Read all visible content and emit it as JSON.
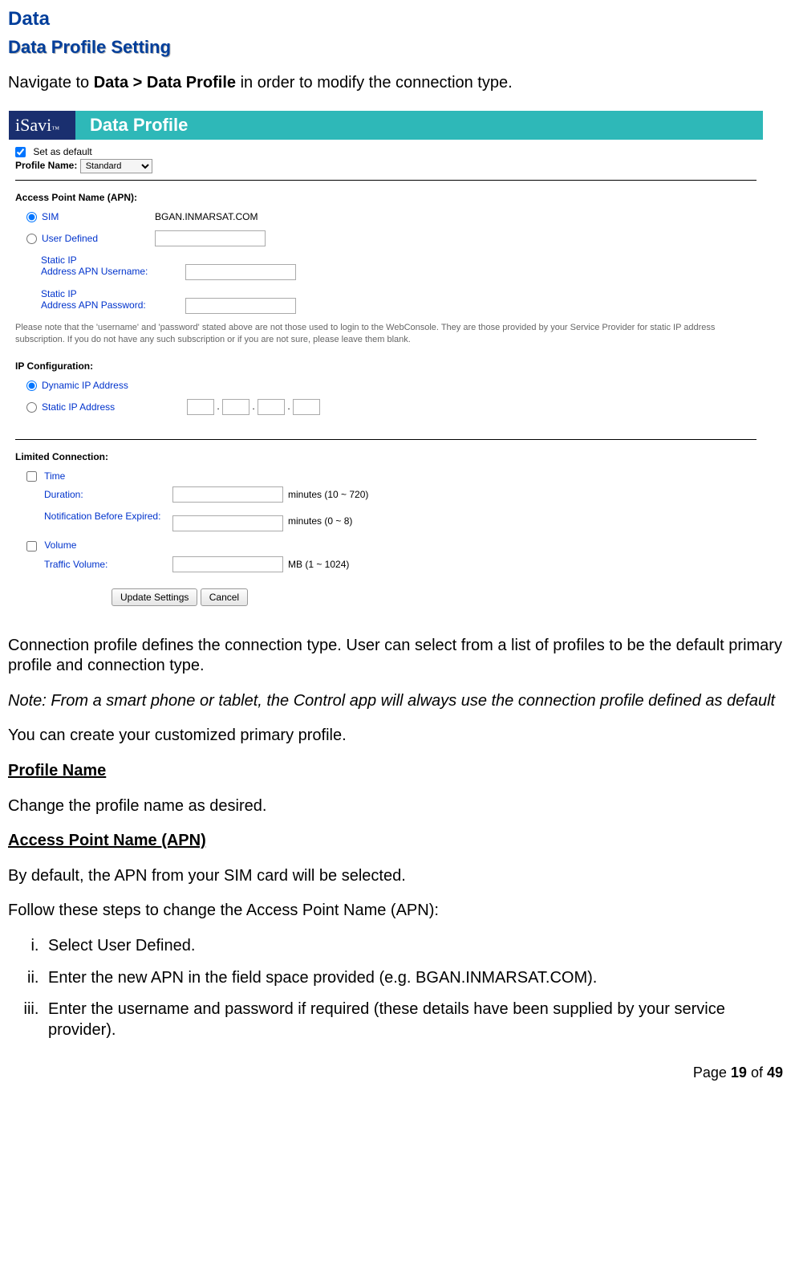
{
  "doc": {
    "h1": "Data",
    "h2": "Data Profile Setting",
    "nav_pre": "Navigate to ",
    "nav_bold": "Data > Data Profile",
    "nav_post": " in order to modify the connection type.",
    "p1": "Connection profile defines the connection type. User can select from a list of profiles to be the default primary profile and connection type.",
    "p2": "Note: From a smart phone or tablet, the Control app will always use the connection profile defined as default",
    "p3": "You can create your customized primary profile.",
    "hProfile": "Profile Name",
    "p4": "Change the profile name as desired.",
    "hApn": "Access Point Name (APN)",
    "p5": "By default, the APN from your SIM card will be selected.",
    "p6": "Follow these steps to change the Access Point Name (APN):",
    "li1": "Select User Defined.",
    "li2": "Enter the new APN in the field space provided (e.g. BGAN.INMARSAT.COM).",
    "li3": "Enter the username and password if required (these details have been supplied by your service provider).",
    "footer_pre": "Page ",
    "footer_n1": "19",
    "footer_mid": " of ",
    "footer_n2": "49"
  },
  "shot": {
    "brand": "iSavi",
    "title": "Data Profile",
    "setDefault": "Set as default",
    "profileNameLabel": "Profile Name:",
    "profileNameValue": "Standard",
    "apnHeader": "Access Point Name (APN):",
    "simLabel": "SIM",
    "simValue": "BGAN.INMARSAT.COM",
    "userDefinedLabel": "User Defined",
    "staticUser": "Static IP\nAddress APN Username:",
    "staticPass": "Static IP\nAddress APN Password:",
    "apnNote": "Please note that the 'username' and 'password' stated above are not those used to login to the WebConsole. They are those provided by your Service Provider for static IP address subscription. If you do not have any such subscription or if you are not sure, please leave them blank.",
    "ipHeader": "IP Configuration:",
    "dynIp": "Dynamic IP Address",
    "staticIp": "Static IP Address",
    "limitedHeader": "Limited Connection:",
    "timeLabel": "Time",
    "durationLabel": "Duration:",
    "durationUnit": "minutes (10 ~ 720)",
    "notifLabel": "Notification Before Expired:",
    "notifUnit": "minutes (0 ~ 8)",
    "volumeLabel": "Volume",
    "trafficLabel": "Traffic Volume:",
    "trafficUnit": "MB (1 ~ 1024)",
    "btnUpdate": "Update Settings",
    "btnCancel": "Cancel"
  }
}
